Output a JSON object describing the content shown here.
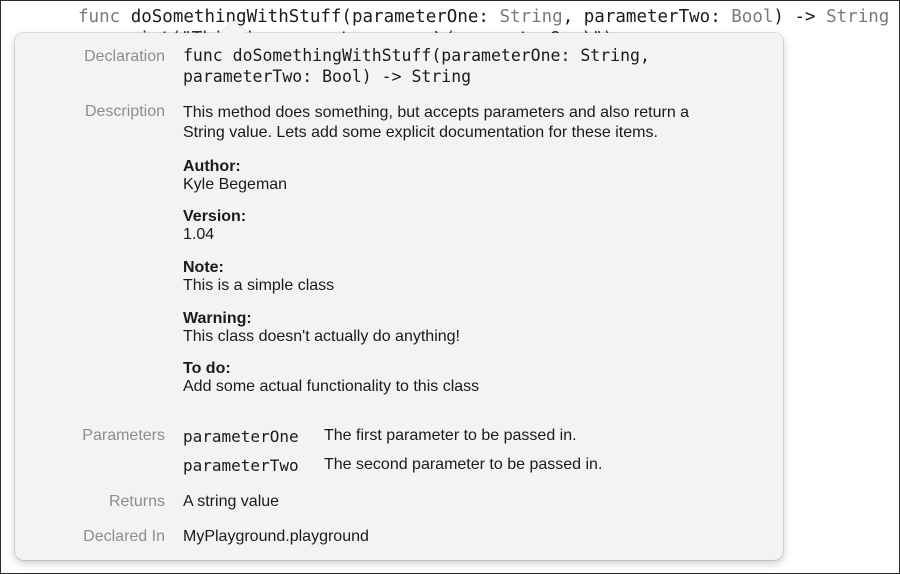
{
  "code": {
    "line1": {
      "keyword": "func",
      "name": "doSomethingWithStuff",
      "p1": "(parameterOne: ",
      "t1": "String",
      "p2": ", parameterTwo: ",
      "t2": "Bool",
      "ret": ") -> ",
      "t3": "String",
      "brace": " {"
    },
    "line2": "print(\"This is parameter one: \\(parameterOne)\")"
  },
  "popover": {
    "declaration": {
      "label": "Declaration",
      "line1": "func doSomethingWithStuff(parameterOne: String,",
      "line2": "parameterTwo: Bool) -> String"
    },
    "description": {
      "label": "Description",
      "line1": "This method does something, but accepts parameters and also return a",
      "line2": "String value. Lets add some explicit documentation for these items."
    },
    "fields": [
      {
        "heading": "Author:",
        "value": "Kyle Begeman"
      },
      {
        "heading": "Version:",
        "value": "1.04"
      },
      {
        "heading": "Note:",
        "value": "This is a simple class"
      },
      {
        "heading": "Warning:",
        "value": "This class doesn't actually do anything!"
      },
      {
        "heading": "To do:",
        "value": "Add some actual functionality to this class"
      }
    ],
    "parameters": {
      "label": "Parameters",
      "items": [
        {
          "name": "parameterOne",
          "desc": "The first parameter to be passed in."
        },
        {
          "name": "parameterTwo",
          "desc": "The second parameter to be passed in."
        }
      ]
    },
    "returns": {
      "label": "Returns",
      "value": "A string value"
    },
    "declared_in": {
      "label": "Declared In",
      "value": "MyPlayground.playground"
    }
  }
}
